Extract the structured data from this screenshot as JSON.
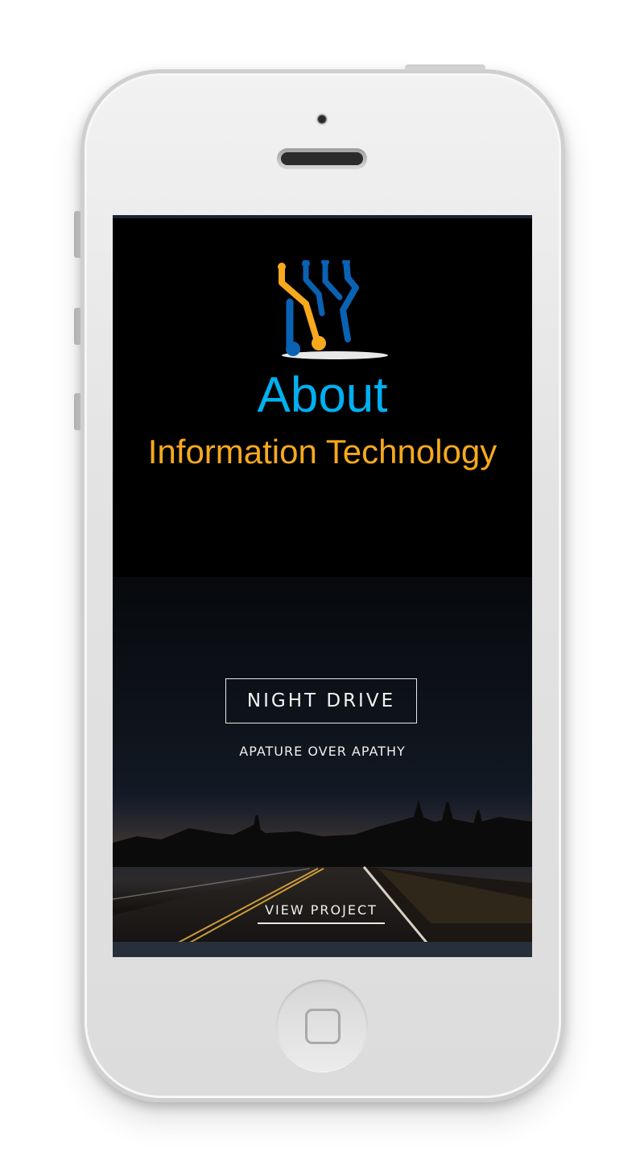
{
  "hero": {
    "title": "About",
    "subtitle": "Information Technology",
    "title_color": "#00b0f0",
    "subtitle_color": "#f6a91c",
    "logo_colors": [
      "#f6a91c",
      "#0a62b3"
    ]
  },
  "project": {
    "name": "NIGHT DRIVE",
    "tagline": "APATURE OVER APATHY",
    "link_label": "VIEW PROJECT"
  },
  "device": {
    "home_button_icon": "home-square-icon",
    "camera_icon": "camera-icon",
    "speaker_icon": "speaker-icon"
  }
}
